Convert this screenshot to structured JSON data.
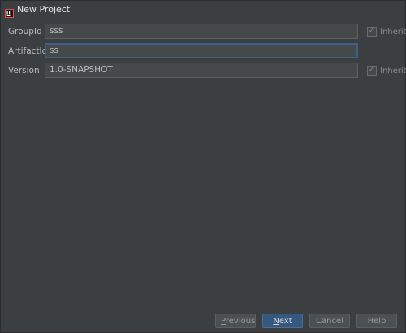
{
  "window": {
    "title": "New Project",
    "icon": "intellij-app-icon"
  },
  "form": {
    "fields": [
      {
        "label": "GroupId",
        "value": "sss",
        "has_inherit": true
      },
      {
        "label": "ArtifactId",
        "value": "ss",
        "has_inherit": false,
        "focused": true
      },
      {
        "label": "Version",
        "value": "1.0-SNAPSHOT",
        "has_inherit": true
      }
    ],
    "inherit_label": "Inherit",
    "inherit_checked": true
  },
  "buttons": {
    "previous_mnemonic": "P",
    "previous_rest": "revious",
    "next_mnemonic": "N",
    "next_rest": "ext",
    "cancel": "Cancel",
    "help": "Help"
  },
  "colors": {
    "background": "#3c3f41",
    "input_background": "#45494a",
    "focus_border": "#3d6185",
    "primary_button": "#365880"
  }
}
